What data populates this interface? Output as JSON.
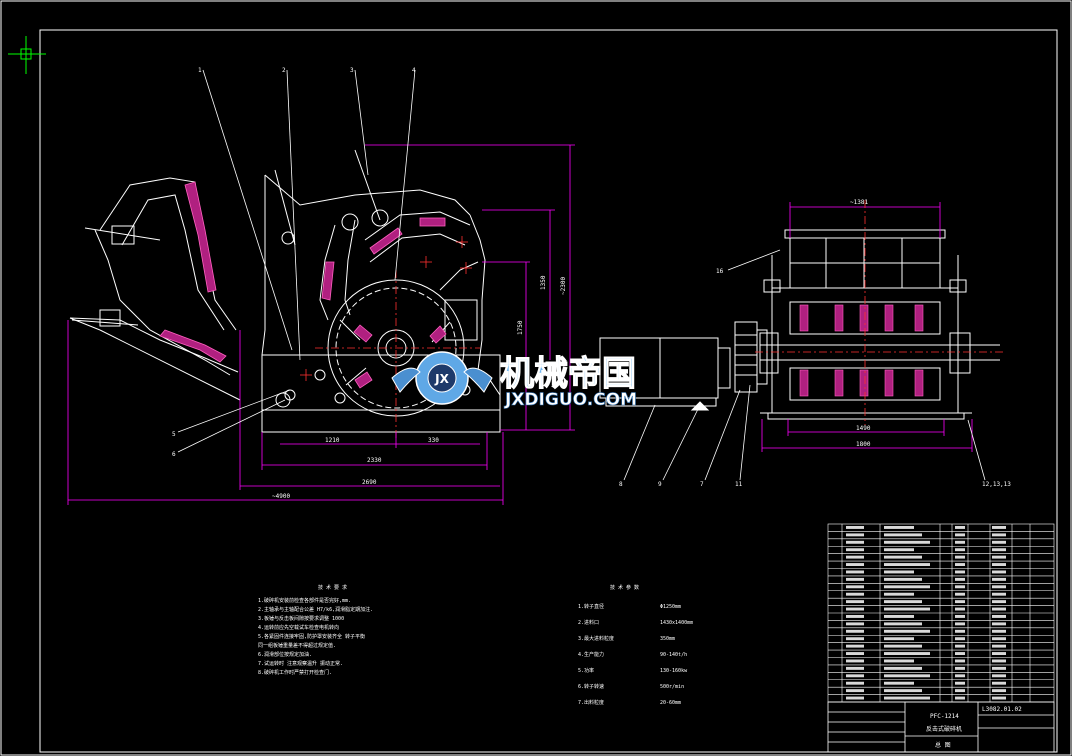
{
  "drawing": {
    "title_block": {
      "model": "PFC-1214",
      "name": "反击式破碎机",
      "drawing_no": "L3082.01.02",
      "sheet": "总 图"
    },
    "dimensions": {
      "side_width_top": "~1381",
      "side_bottom_1": "1490",
      "side_bottom_2": "1800",
      "front_1210": "1210",
      "front_330": "330",
      "front_2330": "2330",
      "front_2690": "2690",
      "front_total": "~4900",
      "front_vert_1": "1350",
      "front_vert_2": "1750",
      "front_vert_3": "~2300"
    },
    "part_labels": {
      "top": [
        "1",
        "2",
        "3",
        "4"
      ],
      "left": [
        "5",
        "6"
      ],
      "bottom": [
        "8",
        "9",
        "7",
        "11"
      ],
      "side_left": "16",
      "side_right": "12,13,13"
    },
    "notes": {
      "heading": "技 术 要 求",
      "items": [
        "1.破碎机安装前检查各部件是否完好,mm.",
        "2.主轴承与主轴配合公差 H7/k6,润滑脂定期加注.",
        "3.板锤与反击板间隙按要求调整 1000",
        "4.运转前应先空载试车检查电机转向",
        "5.各紧固件连接牢固,防护罩安装齐全 转子平衡",
        "  同一组板锤重量差不得超过规定值.",
        "6.润滑部位按规定加油.",
        "7.试运转时 注意观察温升 振动正常.",
        "8.破碎机工作时严禁打开检查门."
      ]
    },
    "specs": {
      "heading": "技 术 参 数",
      "rows": [
        {
          "label": "1.转子直径",
          "value": "Φ1250mm"
        },
        {
          "label": "2.进料口",
          "value": "1430x1400mm"
        },
        {
          "label": "3.最大进料粒度",
          "value": "350mm"
        },
        {
          "label": "4.生产能力",
          "value": "90-140t/h"
        },
        {
          "label": "5.功率",
          "value": "130-160kw"
        },
        {
          "label": "6.转子转速",
          "value": "500r/min"
        },
        {
          "label": "7.出料粒度",
          "value": "20-60mm"
        }
      ]
    }
  },
  "watermark": {
    "cn": "机械帝国",
    "en": "JXDIGUO.COM"
  },
  "colors": {
    "background": "#000000",
    "line": "#ffffff",
    "dimension": "#ff00ff",
    "centerline": "#ff3030",
    "accent": "#00ffff",
    "green": "#00ff00",
    "yellow": "#ffff00",
    "watermark_fill": "#5fa8e6"
  }
}
